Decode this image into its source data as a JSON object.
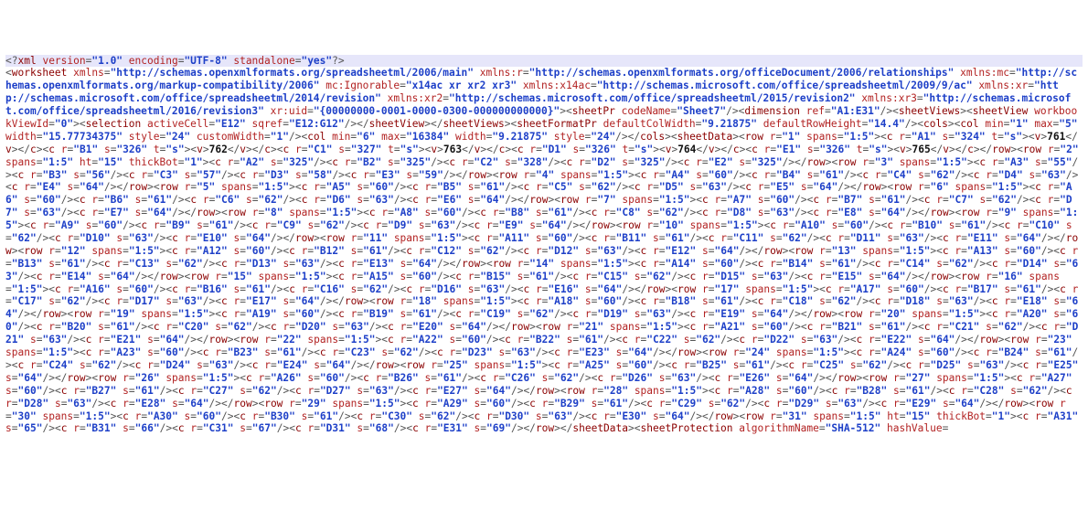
{
  "xml_declaration": {
    "version": "1.0",
    "encoding": "UTF-8",
    "standalone": "yes"
  },
  "worksheet_attrs": {
    "xmlns": "http://schemas.openxmlformats.org/spreadsheetml/2006/main",
    "xmlns:r": "http://schemas.openxmlformats.org/officeDocument/2006/relationships",
    "xmlns:mc": "http://schemas.openxmlformats.org/markup-compatibility/2006",
    "mc:Ignorable": "x14ac xr xr2 xr3",
    "xmlns:x14ac": "http://schemas.microsoft.com/office/spreadsheetml/2009/9/ac",
    "xmlns:xr": "http://schemas.microsoft.com/office/spreadsheetml/2014/revision",
    "xmlns:xr2": "http://schemas.microsoft.com/office/spreadsheetml/2015/revision2",
    "xmlns:xr3": "http://schemas.microsoft.com/office/spreadsheetml/2016/revision3",
    "xr:uid": "{00000000-0001-0000-0300-000000000000}"
  },
  "sheetPr": {
    "codeName": "Sheet7"
  },
  "dimension": {
    "ref": "A1:E31"
  },
  "sheetView": {
    "workbookViewId": "0",
    "selection": {
      "activeCell": "E12",
      "sqref": "E12:G12"
    }
  },
  "sheetFormatPr": {
    "defaultColWidth": "9.21875",
    "defaultRowHeight": "14.4"
  },
  "cols": [
    {
      "min": "1",
      "max": "5",
      "width": "15.77734375",
      "style": "24",
      "customWidth": "1"
    },
    {
      "min": "6",
      "max": "16384",
      "width": "9.21875",
      "style": "24"
    }
  ],
  "sheetData_rows": [
    {
      "r": "1",
      "spans": "1:5",
      "c": [
        {
          "r": "A1",
          "s": "324",
          "t": "s",
          "v": "761"
        },
        {
          "r": "B1",
          "s": "326",
          "t": "s",
          "v": "762"
        },
        {
          "r": "C1",
          "s": "327",
          "t": "s",
          "v": "763"
        },
        {
          "r": "D1",
          "s": "326",
          "t": "s",
          "v": "764"
        },
        {
          "r": "E1",
          "s": "326",
          "t": "s",
          "v": "765"
        }
      ]
    },
    {
      "r": "2",
      "spans": "1:5",
      "ht": "15",
      "thickBot": "1",
      "c": [
        {
          "r": "A2",
          "s": "325"
        },
        {
          "r": "B2",
          "s": "325"
        },
        {
          "r": "C2",
          "s": "328"
        },
        {
          "r": "D2",
          "s": "325"
        },
        {
          "r": "E2",
          "s": "325"
        }
      ]
    },
    {
      "r": "3",
      "spans": "1:5",
      "c": [
        {
          "r": "A3",
          "s": "55"
        },
        {
          "r": "B3",
          "s": "56"
        },
        {
          "r": "C3",
          "s": "57"
        },
        {
          "r": "D3",
          "s": "58"
        },
        {
          "r": "E3",
          "s": "59"
        }
      ]
    },
    {
      "r": "4",
      "spans": "1:5",
      "c": [
        {
          "r": "A4",
          "s": "60"
        },
        {
          "r": "B4",
          "s": "61"
        },
        {
          "r": "C4",
          "s": "62"
        },
        {
          "r": "D4",
          "s": "63"
        },
        {
          "r": "E4",
          "s": "64"
        }
      ]
    },
    {
      "r": "5",
      "spans": "1:5",
      "c": [
        {
          "r": "A5",
          "s": "60"
        },
        {
          "r": "B5",
          "s": "61"
        },
        {
          "r": "C5",
          "s": "62"
        },
        {
          "r": "D5",
          "s": "63"
        },
        {
          "r": "E5",
          "s": "64"
        }
      ]
    },
    {
      "r": "6",
      "spans": "1:5",
      "c": [
        {
          "r": "A6",
          "s": "60"
        },
        {
          "r": "B6",
          "s": "61"
        },
        {
          "r": "C6",
          "s": "62"
        },
        {
          "r": "D6",
          "s": "63"
        },
        {
          "r": "E6",
          "s": "64"
        }
      ]
    },
    {
      "r": "7",
      "spans": "1:5",
      "c": [
        {
          "r": "A7",
          "s": "60"
        },
        {
          "r": "B7",
          "s": "61"
        },
        {
          "r": "C7",
          "s": "62"
        },
        {
          "r": "D7",
          "s": "63"
        },
        {
          "r": "E7",
          "s": "64"
        }
      ]
    },
    {
      "r": "8",
      "spans": "1:5",
      "c": [
        {
          "r": "A8",
          "s": "60"
        },
        {
          "r": "B8",
          "s": "61"
        },
        {
          "r": "C8",
          "s": "62"
        },
        {
          "r": "D8",
          "s": "63"
        },
        {
          "r": "E8",
          "s": "64"
        }
      ]
    },
    {
      "r": "9",
      "spans": "1:5",
      "c": [
        {
          "r": "A9",
          "s": "60"
        },
        {
          "r": "B9",
          "s": "61"
        },
        {
          "r": "C9",
          "s": "62"
        },
        {
          "r": "D9",
          "s": "63"
        },
        {
          "r": "E9",
          "s": "64"
        }
      ]
    },
    {
      "r": "10",
      "spans": "1:5",
      "c": [
        {
          "r": "A10",
          "s": "60"
        },
        {
          "r": "B10",
          "s": "61"
        },
        {
          "r": "C10",
          "s": "62"
        },
        {
          "r": "D10",
          "s": "63"
        },
        {
          "r": "E10",
          "s": "64"
        }
      ]
    },
    {
      "r": "11",
      "spans": "1:5",
      "c": [
        {
          "r": "A11",
          "s": "60"
        },
        {
          "r": "B11",
          "s": "61"
        },
        {
          "r": "C11",
          "s": "62"
        },
        {
          "r": "D11",
          "s": "63"
        },
        {
          "r": "E11",
          "s": "64"
        }
      ]
    },
    {
      "r": "12",
      "spans": "1:5",
      "c": [
        {
          "r": "A12",
          "s": "60"
        },
        {
          "r": "B12",
          "s": "61"
        },
        {
          "r": "C12",
          "s": "62"
        },
        {
          "r": "D12",
          "s": "63"
        },
        {
          "r": "E12",
          "s": "64"
        }
      ]
    },
    {
      "r": "13",
      "spans": "1:5",
      "c": [
        {
          "r": "A13",
          "s": "60"
        },
        {
          "r": "B13",
          "s": "61"
        },
        {
          "r": "C13",
          "s": "62"
        },
        {
          "r": "D13",
          "s": "63"
        },
        {
          "r": "E13",
          "s": "64"
        }
      ]
    },
    {
      "r": "14",
      "spans": "1:5",
      "c": [
        {
          "r": "A14",
          "s": "60"
        },
        {
          "r": "B14",
          "s": "61"
        },
        {
          "r": "C14",
          "s": "62"
        },
        {
          "r": "D14",
          "s": "63"
        },
        {
          "r": "E14",
          "s": "64"
        }
      ]
    },
    {
      "r": "15",
      "spans": "1:5",
      "c": [
        {
          "r": "A15",
          "s": "60"
        },
        {
          "r": "B15",
          "s": "61"
        },
        {
          "r": "C15",
          "s": "62"
        },
        {
          "r": "D15",
          "s": "63"
        },
        {
          "r": "E15",
          "s": "64"
        }
      ]
    },
    {
      "r": "16",
      "spans": "1:5",
      "c": [
        {
          "r": "A16",
          "s": "60"
        },
        {
          "r": "B16",
          "s": "61"
        },
        {
          "r": "C16",
          "s": "62"
        },
        {
          "r": "D16",
          "s": "63"
        },
        {
          "r": "E16",
          "s": "64"
        }
      ]
    },
    {
      "r": "17",
      "spans": "1:5",
      "c": [
        {
          "r": "A17",
          "s": "60"
        },
        {
          "r": "B17",
          "s": "61"
        },
        {
          "r": "C17",
          "s": "62"
        },
        {
          "r": "D17",
          "s": "63"
        },
        {
          "r": "E17",
          "s": "64"
        }
      ]
    },
    {
      "r": "18",
      "spans": "1:5",
      "c": [
        {
          "r": "A18",
          "s": "60"
        },
        {
          "r": "B18",
          "s": "61"
        },
        {
          "r": "C18",
          "s": "62"
        },
        {
          "r": "D18",
          "s": "63"
        },
        {
          "r": "E18",
          "s": "64"
        }
      ]
    },
    {
      "r": "19",
      "spans": "1:5",
      "c": [
        {
          "r": "A19",
          "s": "60"
        },
        {
          "r": "B19",
          "s": "61"
        },
        {
          "r": "C19",
          "s": "62"
        },
        {
          "r": "D19",
          "s": "63"
        },
        {
          "r": "E19",
          "s": "64"
        }
      ]
    },
    {
      "r": "20",
      "spans": "1:5",
      "c": [
        {
          "r": "A20",
          "s": "60"
        },
        {
          "r": "B20",
          "s": "61"
        },
        {
          "r": "C20",
          "s": "62"
        },
        {
          "r": "D20",
          "s": "63"
        },
        {
          "r": "E20",
          "s": "64"
        }
      ]
    },
    {
      "r": "21",
      "spans": "1:5",
      "c": [
        {
          "r": "A21",
          "s": "60"
        },
        {
          "r": "B21",
          "s": "61"
        },
        {
          "r": "C21",
          "s": "62"
        },
        {
          "r": "D21",
          "s": "63"
        },
        {
          "r": "E21",
          "s": "64"
        }
      ]
    },
    {
      "r": "22",
      "spans": "1:5",
      "c": [
        {
          "r": "A22",
          "s": "60"
        },
        {
          "r": "B22",
          "s": "61"
        },
        {
          "r": "C22",
          "s": "62"
        },
        {
          "r": "D22",
          "s": "63"
        },
        {
          "r": "E22",
          "s": "64"
        }
      ]
    },
    {
      "r": "23",
      "spans": "1:5",
      "c": [
        {
          "r": "A23",
          "s": "60"
        },
        {
          "r": "B23",
          "s": "61"
        },
        {
          "r": "C23",
          "s": "62"
        },
        {
          "r": "D23",
          "s": "63"
        },
        {
          "r": "E23",
          "s": "64"
        }
      ]
    },
    {
      "r": "24",
      "spans": "1:5",
      "c": [
        {
          "r": "A24",
          "s": "60"
        },
        {
          "r": "B24",
          "s": "61"
        },
        {
          "r": "C24",
          "s": "62"
        },
        {
          "r": "D24",
          "s": "63"
        },
        {
          "r": "E24",
          "s": "64"
        }
      ]
    },
    {
      "r": "25",
      "spans": "1:5",
      "c": [
        {
          "r": "A25",
          "s": "60"
        },
        {
          "r": "B25",
          "s": "61"
        },
        {
          "r": "C25",
          "s": "62"
        },
        {
          "r": "D25",
          "s": "63"
        },
        {
          "r": "E25",
          "s": "64"
        }
      ]
    },
    {
      "r": "26",
      "spans": "1:5",
      "c": [
        {
          "r": "A26",
          "s": "60"
        },
        {
          "r": "B26",
          "s": "61"
        },
        {
          "r": "C26",
          "s": "62"
        },
        {
          "r": "D26",
          "s": "63"
        },
        {
          "r": "E26",
          "s": "64"
        }
      ]
    },
    {
      "r": "27",
      "spans": "1:5",
      "c": [
        {
          "r": "A27",
          "s": "60"
        },
        {
          "r": "B27",
          "s": "61"
        },
        {
          "r": "C27",
          "s": "62"
        },
        {
          "r": "D27",
          "s": "63"
        },
        {
          "r": "E27",
          "s": "64"
        }
      ]
    },
    {
      "r": "28",
      "spans": "1:5",
      "c": [
        {
          "r": "A28",
          "s": "60"
        },
        {
          "r": "B28",
          "s": "61"
        },
        {
          "r": "C28",
          "s": "62"
        },
        {
          "r": "D28",
          "s": "63"
        },
        {
          "r": "E28",
          "s": "64"
        }
      ]
    },
    {
      "r": "29",
      "spans": "1:5",
      "c": [
        {
          "r": "A29",
          "s": "60"
        },
        {
          "r": "B29",
          "s": "61"
        },
        {
          "r": "C29",
          "s": "62"
        },
        {
          "r": "D29",
          "s": "63"
        },
        {
          "r": "E29",
          "s": "64"
        }
      ]
    },
    {
      "r": "30",
      "spans": "1:5",
      "c": [
        {
          "r": "A30",
          "s": "60"
        },
        {
          "r": "B30",
          "s": "61"
        },
        {
          "r": "C30",
          "s": "62"
        },
        {
          "r": "D30",
          "s": "63"
        },
        {
          "r": "E30",
          "s": "64"
        }
      ]
    },
    {
      "r": "31",
      "spans": "1:5",
      "ht": "15",
      "thickBot": "1",
      "c": [
        {
          "r": "A31",
          "s": "65"
        },
        {
          "r": "B31",
          "s": "66"
        },
        {
          "r": "C31",
          "s": "67"
        },
        {
          "r": "D31",
          "s": "68"
        },
        {
          "r": "E31",
          "s": "69"
        }
      ]
    }
  ],
  "sheetProtection": {
    "algorithmName": "SHA-512",
    "hashValue": ""
  }
}
